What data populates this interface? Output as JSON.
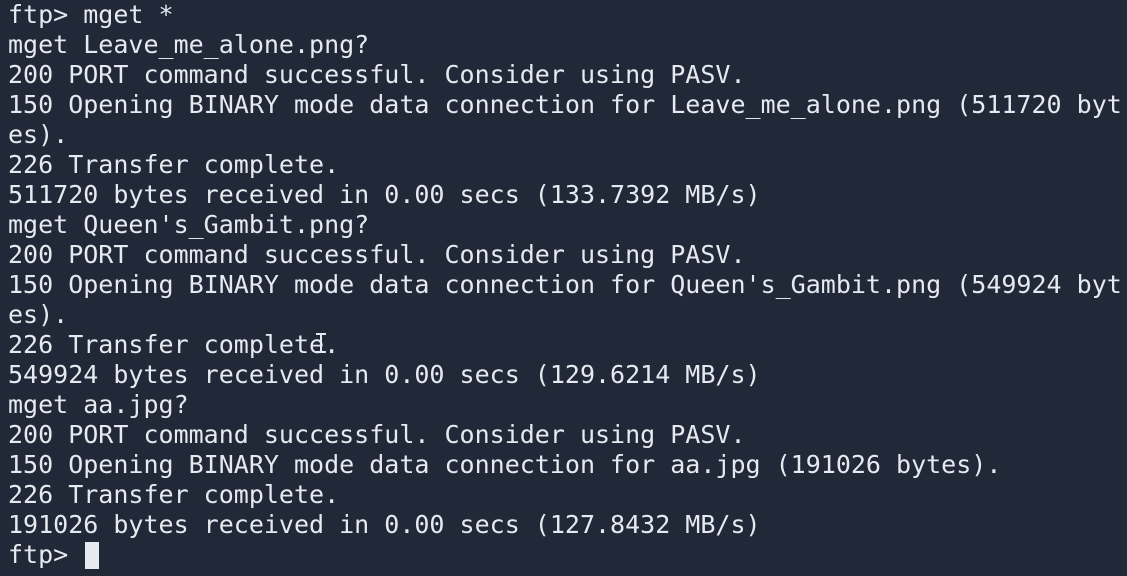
{
  "terminal": {
    "lines": [
      "ftp> mget *",
      "mget Leave_me_alone.png?",
      "200 PORT command successful. Consider using PASV.",
      "150 Opening BINARY mode data connection for Leave_me_alone.png (511720 byt",
      "es).",
      "226 Transfer complete.",
      "511720 bytes received in 0.00 secs (133.7392 MB/s)",
      "mget Queen's_Gambit.png?",
      "200 PORT command successful. Consider using PASV.",
      "150 Opening BINARY mode data connection for Queen's_Gambit.png (549924 byt",
      "es).",
      "226 Transfer complete.",
      "549924 bytes received in 0.00 secs (129.6214 MB/s)",
      "mget aa.jpg?",
      "200 PORT command successful. Consider using PASV.",
      "150 Opening BINARY mode data connection for aa.jpg (191026 bytes).",
      "226 Transfer complete.",
      "191026 bytes received in 0.00 secs (127.8432 MB/s)"
    ],
    "prompt": "ftp> "
  },
  "colors": {
    "background": "#212838",
    "foreground": "#e6e9ef"
  }
}
